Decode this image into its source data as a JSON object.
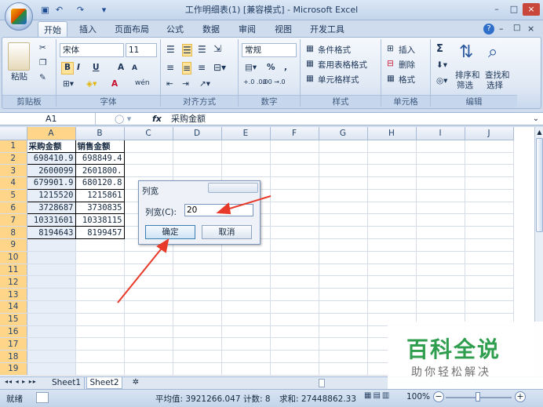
{
  "window": {
    "title": "工作明细表(1)  [兼容模式] - Microsoft Excel",
    "controls": [
      "–",
      "□",
      "×"
    ]
  },
  "quick_access": [
    "save-icon",
    "undo-icon",
    "redo-icon",
    "customize-icon"
  ],
  "tabs": [
    "开始",
    "插入",
    "页面布局",
    "公式",
    "数据",
    "审阅",
    "视图",
    "开发工具"
  ],
  "active_tab": "开始",
  "ribbon_right": [
    "?",
    "–",
    "□",
    "×"
  ],
  "ribbon": {
    "clipboard": {
      "label": "剪贴板",
      "paste": "粘贴"
    },
    "font": {
      "label": "字体",
      "name": "宋体",
      "size": "11",
      "bold": "B",
      "italic": "I",
      "underline": "U",
      "grow": "A",
      "shrink": "A",
      "font_color": "A",
      "phonetic": "wén"
    },
    "alignment": {
      "label": "对齐方式"
    },
    "number": {
      "label": "数字",
      "format": "常规",
      "percent": "%",
      "comma": ",",
      "inc_decimal": "+.0 .00",
      "dec_decimal": ".00 →.0"
    },
    "styles": {
      "label": "样式",
      "conditional": "条件格式",
      "table_format": "套用表格格式",
      "cell_styles": "单元格样式"
    },
    "cells": {
      "label": "单元格",
      "insert": "插入",
      "delete": "删除",
      "format": "格式"
    },
    "editing": {
      "label": "编辑",
      "sum": "Σ",
      "sort_filter": "排序和\n筛选",
      "sort_filter_line1": "排序和",
      "sort_filter_line2": "筛选",
      "find_select_line1": "查找和",
      "find_select_line2": "选择"
    }
  },
  "formula_bar": {
    "name_box": "A1",
    "fx": "fx",
    "content": "采购金额"
  },
  "sheet": {
    "columns": [
      "A",
      "B",
      "C",
      "D",
      "E",
      "F",
      "G",
      "H",
      "I",
      "J"
    ],
    "rows": [
      [
        "1",
        "采购金额",
        "销售金额"
      ],
      [
        "2",
        "698410.9",
        "698849.4"
      ],
      [
        "3",
        "2600099",
        "2601800."
      ],
      [
        "4",
        "679901.9",
        "680120.8"
      ],
      [
        "5",
        "1215520",
        "1215861"
      ],
      [
        "6",
        "3728687",
        "3730835"
      ],
      [
        "7",
        "10331601",
        "10338115"
      ],
      [
        "8",
        "8194643",
        "8199457"
      ],
      [
        "9",
        "",
        ""
      ],
      [
        "10",
        "",
        ""
      ],
      [
        "11",
        "",
        ""
      ],
      [
        "12",
        "",
        ""
      ],
      [
        "13",
        "",
        ""
      ],
      [
        "14",
        "",
        ""
      ],
      [
        "15",
        "",
        ""
      ],
      [
        "16",
        "",
        ""
      ],
      [
        "17",
        "",
        ""
      ],
      [
        "18",
        "",
        ""
      ],
      [
        "19",
        "",
        ""
      ]
    ]
  },
  "dialog": {
    "title": "列宽",
    "field_label": "列宽(C):",
    "field_value": "20",
    "ok": "确定",
    "cancel": "取消"
  },
  "sheet_tabs": {
    "nav": "◂◂ ◂ ▸ ▸▸",
    "tabs": [
      "Sheet1",
      "Sheet2"
    ],
    "active": "Sheet2"
  },
  "status": {
    "ready": "就绪",
    "average": "平均值: 3921266.047",
    "count": "计数: 8",
    "sum": "求和: 27448862.33",
    "zoom": "100%"
  },
  "watermark": {
    "title": "百科全说",
    "subtitle": "助你轻松解决"
  },
  "colors": {
    "accent": "#1f4e8c",
    "selection": "#ffd58a",
    "arrow": "#e83a2a"
  }
}
